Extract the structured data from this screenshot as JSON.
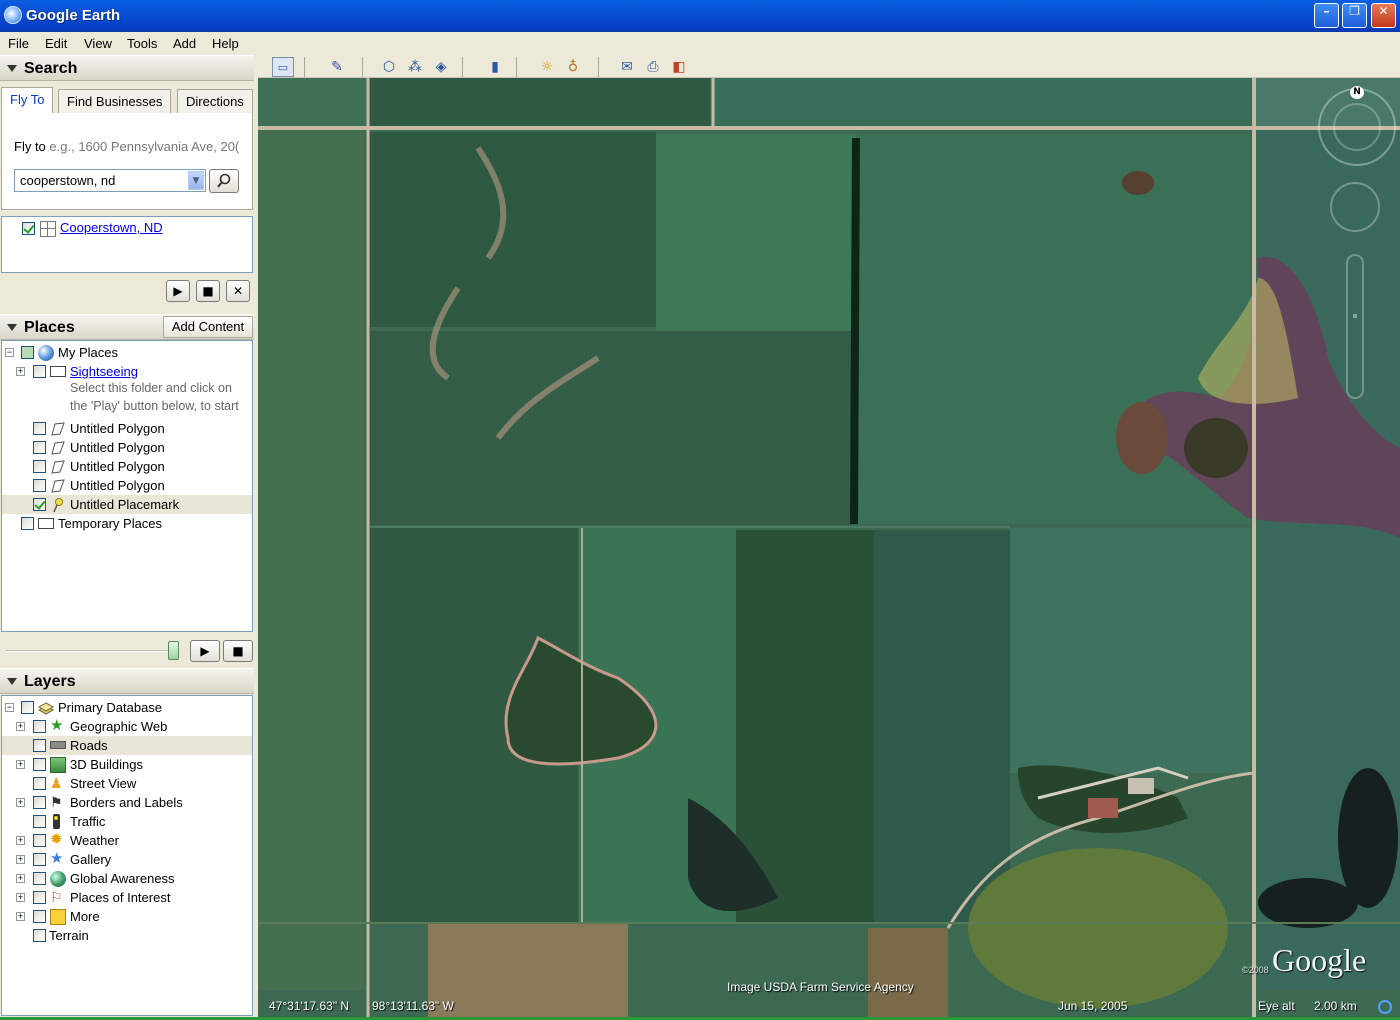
{
  "window": {
    "title": "Google Earth",
    "minimize": "–",
    "maximize": "❐",
    "close": "✕"
  },
  "menu": [
    "File",
    "Edit",
    "View",
    "Tools",
    "Add",
    "Help"
  ],
  "search": {
    "header": "Search",
    "tabs": [
      "Fly To",
      "Find Businesses",
      "Directions"
    ],
    "fly_label": "Fly to",
    "fly_hint": "e.g., 1600 Pennsylvania Ave, 20(",
    "input_value": "cooperstown, nd",
    "result": "Cooperstown, ND"
  },
  "places": {
    "header": "Places",
    "add_content": "Add Content",
    "my_places": "My Places",
    "sightseeing": "Sightseeing",
    "sightseeing_desc1": "Select this folder and click on",
    "sightseeing_desc2": "the 'Play' button below, to start",
    "polygons": [
      "Untitled Polygon",
      "Untitled Polygon",
      "Untitled Polygon",
      "Untitled Polygon"
    ],
    "placemark": "Untitled Placemark",
    "temporary": "Temporary Places"
  },
  "layers": {
    "header": "Layers",
    "items": [
      "Primary Database",
      "Geographic Web",
      "Roads",
      "3D Buildings",
      "Street View",
      "Borders and Labels",
      "Traffic",
      "Weather",
      "Gallery",
      "Global Awareness",
      "Places of Interest",
      "More",
      "Terrain"
    ]
  },
  "map": {
    "attribution": "Image USDA Farm Service Agency",
    "lat": "47°31'17.63\" N",
    "lon": "98°13'11.63\" W",
    "date": "Jun 15, 2005",
    "eye_alt_label": "Eye alt",
    "eye_alt_value": "2.00 km",
    "logo": "Google",
    "copyright": "©2008",
    "compass_n": "N"
  }
}
